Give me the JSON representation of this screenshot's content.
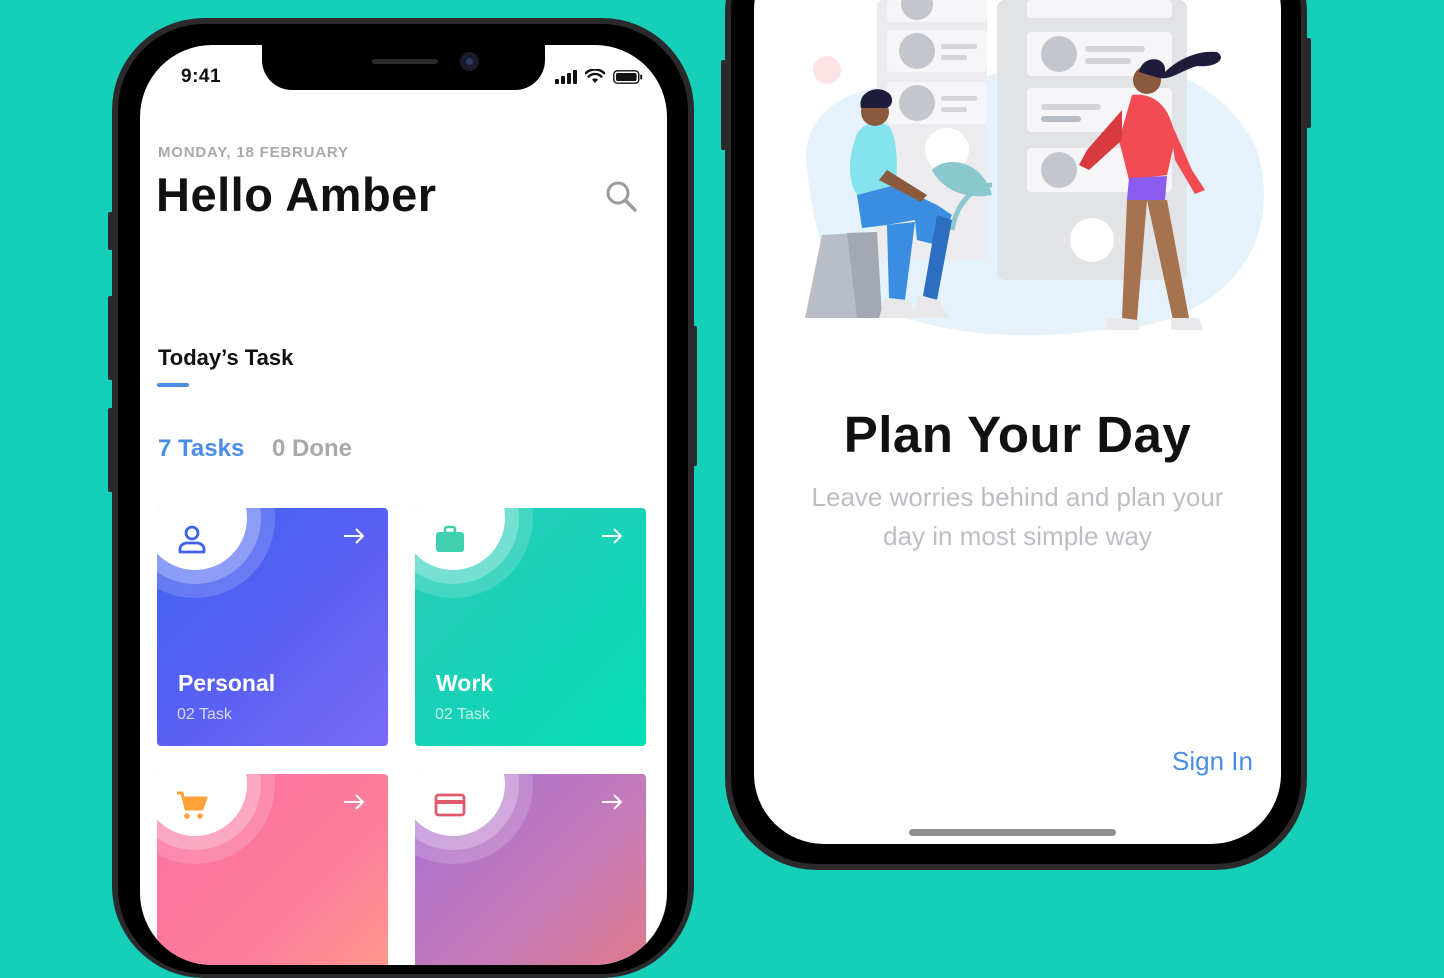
{
  "left_phone": {
    "status_bar": {
      "time": "9:41"
    },
    "header": {
      "date": "MONDAY, 18 FEBRUARY",
      "greeting": "Hello Amber",
      "search_icon": "search-icon"
    },
    "section": {
      "title": "Today’s Task"
    },
    "summary": {
      "tasks": "7 Tasks",
      "done": "0 Done"
    },
    "cards": [
      {
        "title": "Personal",
        "subtitle": "02 Task",
        "icon": "person-icon",
        "color": "#4d63f2"
      },
      {
        "title": "Work",
        "subtitle": "02 Task",
        "icon": "briefcase-icon",
        "color": "#17d1b6"
      },
      {
        "title": "",
        "subtitle": "",
        "icon": "cart-icon",
        "color": "#fd7f9a"
      },
      {
        "title": "",
        "subtitle": "",
        "icon": "credit-card-icon",
        "color": "#c77bb8"
      }
    ]
  },
  "right_phone": {
    "title": "Plan Your Day",
    "subtitle": "Leave worries behind and plan your day in most simple way",
    "sign_in": "Sign In"
  },
  "colors": {
    "background": "#16cfb9",
    "accent": "#4a8de8",
    "muted": "#a9a9ad"
  }
}
